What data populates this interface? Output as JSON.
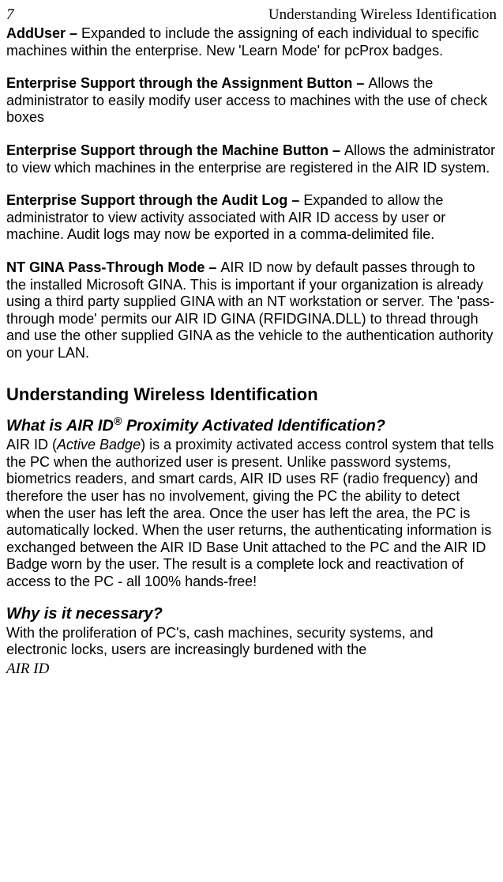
{
  "header": {
    "page_number": "7",
    "title": "Understanding Wireless Identification"
  },
  "features": {
    "adduser": {
      "label": "AddUser – ",
      "text": "Expanded to include the assigning of each individual to specific machines within the enterprise. New 'Learn Mode' for pcProx badges."
    },
    "assignment": {
      "label": "Enterprise Support through the Assignment Button – ",
      "text": "Allows the administrator to easily modify user access to machines with the use of check boxes"
    },
    "machine": {
      "label": "Enterprise Support through the Machine Button – ",
      "text": "Allows the administrator to view which machines in the enterprise are registered in the AIR ID system."
    },
    "audit": {
      "label": "Enterprise Support through the Audit Log – ",
      "text": "Expanded to allow the administrator to view activity associated with AIR ID access by user or machine. Audit logs may now be exported in a comma-delimited file."
    },
    "gina": {
      "label": "NT GINA Pass-Through Mode – ",
      "text": "AIR ID now by default passes through to the installed Microsoft GINA. This is important if your organization is already using a third party supplied GINA with an NT workstation or server.  The 'pass-through mode' permits our AIR ID GINA (RFIDGINA.DLL) to thread through and use the other supplied GINA as the vehicle to the authentication authority on your LAN."
    }
  },
  "section": {
    "heading": "Understanding Wireless Identification",
    "what": {
      "heading_pre": "What is AIR ID",
      "heading_sup": "®",
      "heading_post": " Proximity Activated Identification?",
      "body_pre": "AIR ID (",
      "body_italic": "Active Badge",
      "body_post": ") is a proximity activated access control system that tells the PC when the authorized user is present.  Unlike password systems, biometrics readers, and smart cards, AIR ID uses RF (radio frequency) and therefore the user has no involvement, giving the PC the ability to detect when the user has left the area.  Once the user has left the area, the PC is automatically locked.  When the user returns, the authenticating information is exchanged between the AIR ID Base Unit attached to the PC and the AIR ID Badge worn by the user.  The result is a complete lock and reactivation of access to the PC - all 100% hands-free!"
    },
    "why": {
      "heading": "Why is it necessary?",
      "body": "With the proliferation of PC's, cash machines, security systems, and electronic locks, users are increasingly burdened with the"
    }
  },
  "footer": {
    "text": "AIR ID"
  }
}
